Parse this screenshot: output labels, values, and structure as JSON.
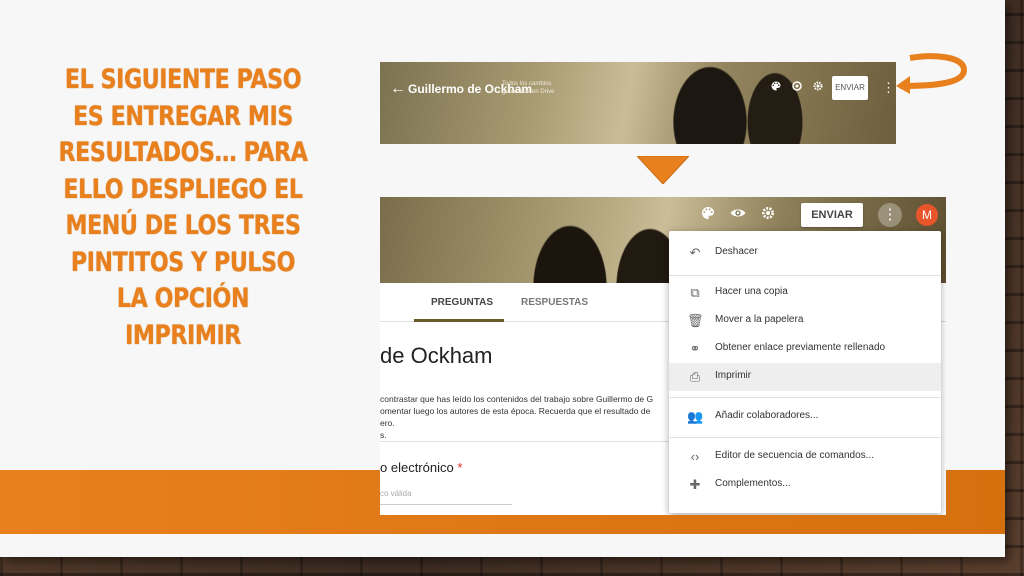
{
  "slide": {
    "title": "EL SIGUIENTE PASO ES ENTREGAR MIS RESULTADOS… PARA ELLO DESPLIEGO EL MENÚ DE LOS TRES PINTITOS Y PULSO LA OPCIÓN IMPRIMIR"
  },
  "top_header": {
    "back_glyph": "←",
    "form_title": "Guillermo de Ockham",
    "saved_status": "Todos los cambios guardados en Drive",
    "send_label": "ENVIAR",
    "more_glyph": "⋮"
  },
  "bottom_header": {
    "send_label": "ENVIAR",
    "more_glyph": "⋮",
    "avatar_letter": "M"
  },
  "tabs": {
    "questions": "PREGUNTAS",
    "responses": "RESPUESTAS"
  },
  "form": {
    "heading": "de Ockham",
    "description_lines": [
      "contrastar que has leído los contenidos del trabajo sobre Guillermo de G",
      "omentar luego los autores de esta época. Recuerda que el resultado de",
      "ero.",
      "s."
    ],
    "question_label": "o electrónico",
    "required_mark": "*",
    "input_placeholder": "co válida"
  },
  "menu": {
    "items": [
      {
        "label": "Deshacer",
        "icon": "undo-icon"
      },
      {
        "label": "Hacer una copia",
        "icon": "copy-icon"
      },
      {
        "label": "Mover a la papelera",
        "icon": "trash-icon"
      },
      {
        "label": "Obtener enlace previamente rellenado",
        "icon": "link-icon"
      },
      {
        "label": "Imprimir",
        "icon": "print-icon"
      },
      {
        "label": "Añadir colaboradores...",
        "icon": "add-people-icon"
      },
      {
        "label": "Editor de secuencia de comandos...",
        "icon": "code-icon"
      },
      {
        "label": "Complementos...",
        "icon": "puzzle-icon"
      }
    ],
    "highlighted": "Imprimir"
  },
  "colors": {
    "accent_orange": "#e8801d",
    "avatar_red": "#e8552b"
  }
}
